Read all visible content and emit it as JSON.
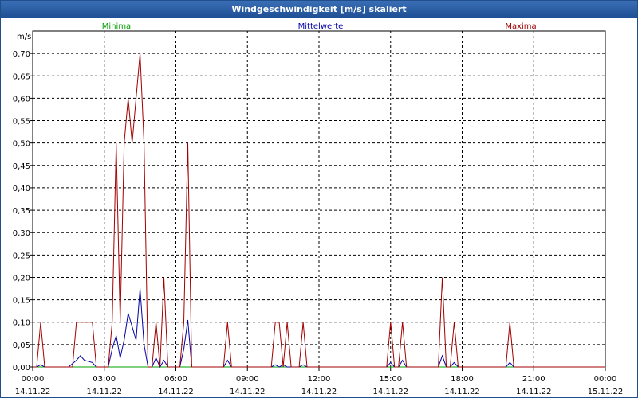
{
  "window": {
    "title": "Windgeschwindigkeit [m/s] skaliert"
  },
  "colors": {
    "min": "#00a000",
    "mean": "#0000a8",
    "max": "#a00000",
    "grid": "#000000",
    "axis": "#000000"
  },
  "chart_data": {
    "type": "line",
    "title": "Windgeschwindigkeit [m/s] skaliert",
    "ylabel": "m/s",
    "ylim": [
      0,
      0.75
    ],
    "yticks": [
      "0,00",
      "0,05",
      "0,10",
      "0,15",
      "0,20",
      "0,25",
      "0,30",
      "0,35",
      "0,40",
      "0,45",
      "0,50",
      "0,55",
      "0,60",
      "0,65",
      "0,70"
    ],
    "xlim": [
      "14.11.22 00:00",
      "15.11.22 00:00"
    ],
    "xticks": [
      {
        "time": "00:00",
        "date": "14.11.22"
      },
      {
        "time": "03:00",
        "date": "14.11.22"
      },
      {
        "time": "06:00",
        "date": "14.11.22"
      },
      {
        "time": "09:00",
        "date": "14.11.22"
      },
      {
        "time": "12:00",
        "date": "14.11.22"
      },
      {
        "time": "15:00",
        "date": "14.11.22"
      },
      {
        "time": "18:00",
        "date": "14.11.22"
      },
      {
        "time": "21:00",
        "date": "14.11.22"
      },
      {
        "time": "00:00",
        "date": "15.11.22"
      }
    ],
    "grid": true,
    "legend_position": "top",
    "series": [
      {
        "name": "Minima",
        "color": "#00a000",
        "points": [
          [
            "00:00",
            0
          ],
          [
            "24:00",
            0
          ]
        ]
      },
      {
        "name": "Mittelwerte",
        "color": "#0000a8",
        "points": [
          [
            "00:00",
            0
          ],
          [
            "00:10",
            0
          ],
          [
            "00:20",
            0.005
          ],
          [
            "00:30",
            0
          ],
          [
            "00:40",
            0
          ],
          [
            "01:30",
            0
          ],
          [
            "01:50",
            0.015
          ],
          [
            "02:00",
            0.025
          ],
          [
            "02:10",
            0.015
          ],
          [
            "02:30",
            0.01
          ],
          [
            "02:40",
            0
          ],
          [
            "03:10",
            0
          ],
          [
            "03:20",
            0.04
          ],
          [
            "03:30",
            0.07
          ],
          [
            "03:40",
            0.02
          ],
          [
            "03:50",
            0.06
          ],
          [
            "04:00",
            0.12
          ],
          [
            "04:10",
            0.09
          ],
          [
            "04:20",
            0.06
          ],
          [
            "04:30",
            0.175
          ],
          [
            "04:40",
            0.05
          ],
          [
            "04:50",
            0
          ],
          [
            "05:00",
            0
          ],
          [
            "05:10",
            0.02
          ],
          [
            "05:20",
            0
          ],
          [
            "05:30",
            0.015
          ],
          [
            "05:40",
            0
          ],
          [
            "06:10",
            0
          ],
          [
            "06:20",
            0.04
          ],
          [
            "06:30",
            0.105
          ],
          [
            "06:40",
            0
          ],
          [
            "08:00",
            0
          ],
          [
            "08:10",
            0.015
          ],
          [
            "08:20",
            0
          ],
          [
            "10:00",
            0
          ],
          [
            "10:10",
            0.005
          ],
          [
            "10:20",
            0
          ],
          [
            "10:30",
            0.005
          ],
          [
            "10:40",
            0
          ],
          [
            "11:10",
            0
          ],
          [
            "11:20",
            0.005
          ],
          [
            "11:30",
            0
          ],
          [
            "14:50",
            0
          ],
          [
            "15:00",
            0.01
          ],
          [
            "15:10",
            0
          ],
          [
            "15:20",
            0
          ],
          [
            "15:30",
            0.015
          ],
          [
            "15:40",
            0
          ],
          [
            "17:00",
            0
          ],
          [
            "17:10",
            0.025
          ],
          [
            "17:20",
            0
          ],
          [
            "17:30",
            0
          ],
          [
            "17:40",
            0.01
          ],
          [
            "17:50",
            0
          ],
          [
            "19:50",
            0
          ],
          [
            "20:00",
            0.01
          ],
          [
            "20:10",
            0
          ],
          [
            "24:00",
            0
          ]
        ]
      },
      {
        "name": "Maxima",
        "color": "#a00000",
        "points": [
          [
            "00:00",
            0
          ],
          [
            "00:10",
            0
          ],
          [
            "00:20",
            0.1
          ],
          [
            "00:30",
            0
          ],
          [
            "01:40",
            0
          ],
          [
            "01:50",
            0.1
          ],
          [
            "02:30",
            0.1
          ],
          [
            "02:40",
            0
          ],
          [
            "03:10",
            0
          ],
          [
            "03:20",
            0.1
          ],
          [
            "03:30",
            0.5
          ],
          [
            "03:40",
            0.1
          ],
          [
            "03:50",
            0.5
          ],
          [
            "04:00",
            0.6
          ],
          [
            "04:10",
            0.5
          ],
          [
            "04:20",
            0.6
          ],
          [
            "04:30",
            0.7
          ],
          [
            "04:40",
            0.5
          ],
          [
            "04:50",
            0
          ],
          [
            "05:00",
            0
          ],
          [
            "05:10",
            0.1
          ],
          [
            "05:20",
            0
          ],
          [
            "05:30",
            0.2
          ],
          [
            "05:40",
            0
          ],
          [
            "06:10",
            0
          ],
          [
            "06:20",
            0.1
          ],
          [
            "06:30",
            0.5
          ],
          [
            "06:40",
            0
          ],
          [
            "08:00",
            0
          ],
          [
            "08:10",
            0.1
          ],
          [
            "08:20",
            0
          ],
          [
            "10:00",
            0
          ],
          [
            "10:10",
            0.1
          ],
          [
            "10:20",
            0.1
          ],
          [
            "10:30",
            0
          ],
          [
            "10:40",
            0.1
          ],
          [
            "10:50",
            0
          ],
          [
            "11:10",
            0
          ],
          [
            "11:20",
            0.1
          ],
          [
            "11:30",
            0
          ],
          [
            "14:50",
            0
          ],
          [
            "15:00",
            0.1
          ],
          [
            "15:10",
            0
          ],
          [
            "15:20",
            0
          ],
          [
            "15:30",
            0.1
          ],
          [
            "15:40",
            0
          ],
          [
            "17:00",
            0
          ],
          [
            "17:10",
            0.2
          ],
          [
            "17:20",
            0
          ],
          [
            "17:30",
            0
          ],
          [
            "17:40",
            0.1
          ],
          [
            "17:50",
            0
          ],
          [
            "19:50",
            0
          ],
          [
            "20:00",
            0.1
          ],
          [
            "20:10",
            0
          ],
          [
            "24:00",
            0
          ]
        ]
      }
    ]
  }
}
